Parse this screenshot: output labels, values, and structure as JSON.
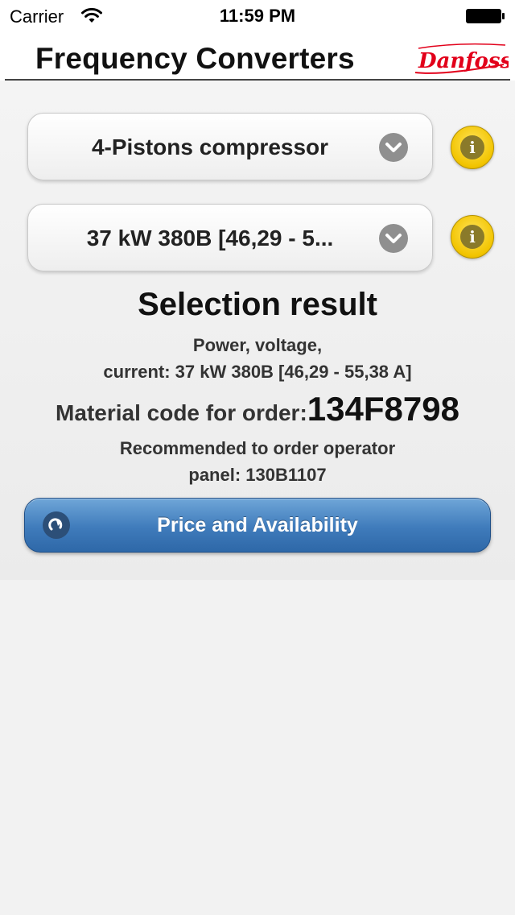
{
  "status_bar": {
    "carrier": "Carrier",
    "time": "11:59 PM"
  },
  "header": {
    "title": "Frequency Converters",
    "logo_text": "Danfoss",
    "brand_color": "#e2001a"
  },
  "selectors": [
    {
      "value": "4-Pistons compressor"
    },
    {
      "value": "37 kW 380B [46,29 - 5..."
    }
  ],
  "result": {
    "heading": "Selection result",
    "power_line_1": "Power, voltage,",
    "power_line_2": "current: 37 kW 380B [46,29 - 55,38 A]",
    "material_label": "Material code for order:",
    "material_code": "134F8798",
    "recommend_line_1": "Recommended to order operator",
    "recommend_line_2": "panel: 130B1107"
  },
  "actions": {
    "price_label": "Price and Availability"
  },
  "colors": {
    "button_blue": "#3f7bbb",
    "info_yellow": "#f2c400"
  }
}
